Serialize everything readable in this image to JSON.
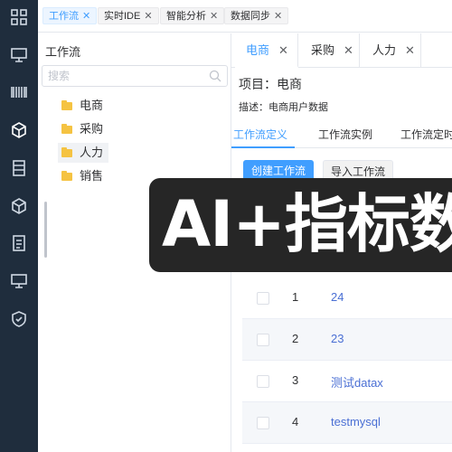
{
  "rail": {
    "icons": [
      "grid-icon",
      "monitor-icon",
      "barcode-icon",
      "cube-icon",
      "server-icon",
      "box-icon",
      "document-icon",
      "desktop-icon",
      "shield-check-icon"
    ]
  },
  "topbar": {
    "tabs": [
      {
        "label": "工作流",
        "active": true
      },
      {
        "label": "实时IDE",
        "active": false
      },
      {
        "label": "智能分析",
        "active": false
      },
      {
        "label": "数据同步",
        "active": false
      }
    ]
  },
  "left": {
    "title": "工作流",
    "search": {
      "placeholder": "搜索"
    },
    "tree": [
      {
        "label": "电商"
      },
      {
        "label": "采购"
      },
      {
        "label": "人力",
        "selected": true
      },
      {
        "label": "销售"
      }
    ]
  },
  "main": {
    "project_tabs": [
      {
        "label": "电商",
        "active": true
      },
      {
        "label": "采购"
      },
      {
        "label": "人力"
      }
    ],
    "project_title": "项目：电商",
    "project_desc": "描述：电商用户数据",
    "sub_tabs": [
      {
        "label": "工作流定义",
        "active": true
      },
      {
        "label": "工作流实例"
      },
      {
        "label": "工作流定时"
      }
    ],
    "create_button": "创建工作流",
    "import_button": "导入工作流",
    "rows": [
      {
        "index": "1",
        "name": "24"
      },
      {
        "index": "2",
        "name": "23"
      },
      {
        "index": "3",
        "name": "测试datax"
      },
      {
        "index": "4",
        "name": "testmysql"
      }
    ]
  },
  "banner": {
    "text": "AI+指标数"
  },
  "colors": {
    "accent": "#409eff",
    "rail": "#1f2d3d",
    "banner": "#262626",
    "link": "#4a6fd4",
    "folder": "#f5c342"
  }
}
